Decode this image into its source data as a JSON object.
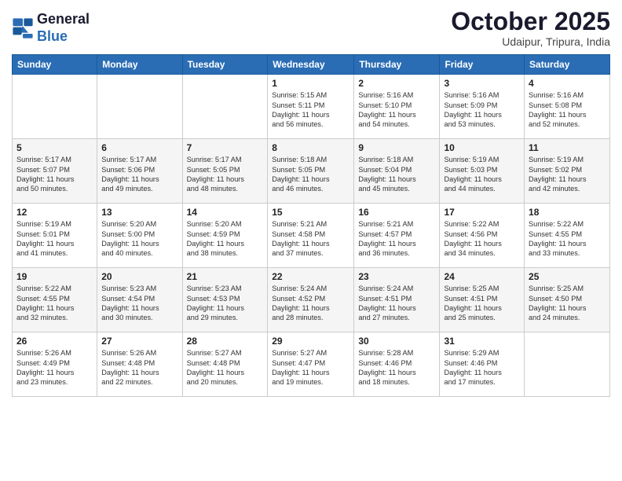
{
  "logo": {
    "line1": "General",
    "line2": "Blue"
  },
  "header": {
    "month": "October 2025",
    "location": "Udaipur, Tripura, India"
  },
  "days_of_week": [
    "Sunday",
    "Monday",
    "Tuesday",
    "Wednesday",
    "Thursday",
    "Friday",
    "Saturday"
  ],
  "weeks": [
    [
      {
        "day": "",
        "info": ""
      },
      {
        "day": "",
        "info": ""
      },
      {
        "day": "",
        "info": ""
      },
      {
        "day": "1",
        "info": "Sunrise: 5:15 AM\nSunset: 5:11 PM\nDaylight: 11 hours\nand 56 minutes."
      },
      {
        "day": "2",
        "info": "Sunrise: 5:16 AM\nSunset: 5:10 PM\nDaylight: 11 hours\nand 54 minutes."
      },
      {
        "day": "3",
        "info": "Sunrise: 5:16 AM\nSunset: 5:09 PM\nDaylight: 11 hours\nand 53 minutes."
      },
      {
        "day": "4",
        "info": "Sunrise: 5:16 AM\nSunset: 5:08 PM\nDaylight: 11 hours\nand 52 minutes."
      }
    ],
    [
      {
        "day": "5",
        "info": "Sunrise: 5:17 AM\nSunset: 5:07 PM\nDaylight: 11 hours\nand 50 minutes."
      },
      {
        "day": "6",
        "info": "Sunrise: 5:17 AM\nSunset: 5:06 PM\nDaylight: 11 hours\nand 49 minutes."
      },
      {
        "day": "7",
        "info": "Sunrise: 5:17 AM\nSunset: 5:05 PM\nDaylight: 11 hours\nand 48 minutes."
      },
      {
        "day": "8",
        "info": "Sunrise: 5:18 AM\nSunset: 5:05 PM\nDaylight: 11 hours\nand 46 minutes."
      },
      {
        "day": "9",
        "info": "Sunrise: 5:18 AM\nSunset: 5:04 PM\nDaylight: 11 hours\nand 45 minutes."
      },
      {
        "day": "10",
        "info": "Sunrise: 5:19 AM\nSunset: 5:03 PM\nDaylight: 11 hours\nand 44 minutes."
      },
      {
        "day": "11",
        "info": "Sunrise: 5:19 AM\nSunset: 5:02 PM\nDaylight: 11 hours\nand 42 minutes."
      }
    ],
    [
      {
        "day": "12",
        "info": "Sunrise: 5:19 AM\nSunset: 5:01 PM\nDaylight: 11 hours\nand 41 minutes."
      },
      {
        "day": "13",
        "info": "Sunrise: 5:20 AM\nSunset: 5:00 PM\nDaylight: 11 hours\nand 40 minutes."
      },
      {
        "day": "14",
        "info": "Sunrise: 5:20 AM\nSunset: 4:59 PM\nDaylight: 11 hours\nand 38 minutes."
      },
      {
        "day": "15",
        "info": "Sunrise: 5:21 AM\nSunset: 4:58 PM\nDaylight: 11 hours\nand 37 minutes."
      },
      {
        "day": "16",
        "info": "Sunrise: 5:21 AM\nSunset: 4:57 PM\nDaylight: 11 hours\nand 36 minutes."
      },
      {
        "day": "17",
        "info": "Sunrise: 5:22 AM\nSunset: 4:56 PM\nDaylight: 11 hours\nand 34 minutes."
      },
      {
        "day": "18",
        "info": "Sunrise: 5:22 AM\nSunset: 4:55 PM\nDaylight: 11 hours\nand 33 minutes."
      }
    ],
    [
      {
        "day": "19",
        "info": "Sunrise: 5:22 AM\nSunset: 4:55 PM\nDaylight: 11 hours\nand 32 minutes."
      },
      {
        "day": "20",
        "info": "Sunrise: 5:23 AM\nSunset: 4:54 PM\nDaylight: 11 hours\nand 30 minutes."
      },
      {
        "day": "21",
        "info": "Sunrise: 5:23 AM\nSunset: 4:53 PM\nDaylight: 11 hours\nand 29 minutes."
      },
      {
        "day": "22",
        "info": "Sunrise: 5:24 AM\nSunset: 4:52 PM\nDaylight: 11 hours\nand 28 minutes."
      },
      {
        "day": "23",
        "info": "Sunrise: 5:24 AM\nSunset: 4:51 PM\nDaylight: 11 hours\nand 27 minutes."
      },
      {
        "day": "24",
        "info": "Sunrise: 5:25 AM\nSunset: 4:51 PM\nDaylight: 11 hours\nand 25 minutes."
      },
      {
        "day": "25",
        "info": "Sunrise: 5:25 AM\nSunset: 4:50 PM\nDaylight: 11 hours\nand 24 minutes."
      }
    ],
    [
      {
        "day": "26",
        "info": "Sunrise: 5:26 AM\nSunset: 4:49 PM\nDaylight: 11 hours\nand 23 minutes."
      },
      {
        "day": "27",
        "info": "Sunrise: 5:26 AM\nSunset: 4:48 PM\nDaylight: 11 hours\nand 22 minutes."
      },
      {
        "day": "28",
        "info": "Sunrise: 5:27 AM\nSunset: 4:48 PM\nDaylight: 11 hours\nand 20 minutes."
      },
      {
        "day": "29",
        "info": "Sunrise: 5:27 AM\nSunset: 4:47 PM\nDaylight: 11 hours\nand 19 minutes."
      },
      {
        "day": "30",
        "info": "Sunrise: 5:28 AM\nSunset: 4:46 PM\nDaylight: 11 hours\nand 18 minutes."
      },
      {
        "day": "31",
        "info": "Sunrise: 5:29 AM\nSunset: 4:46 PM\nDaylight: 11 hours\nand 17 minutes."
      },
      {
        "day": "",
        "info": ""
      }
    ]
  ]
}
